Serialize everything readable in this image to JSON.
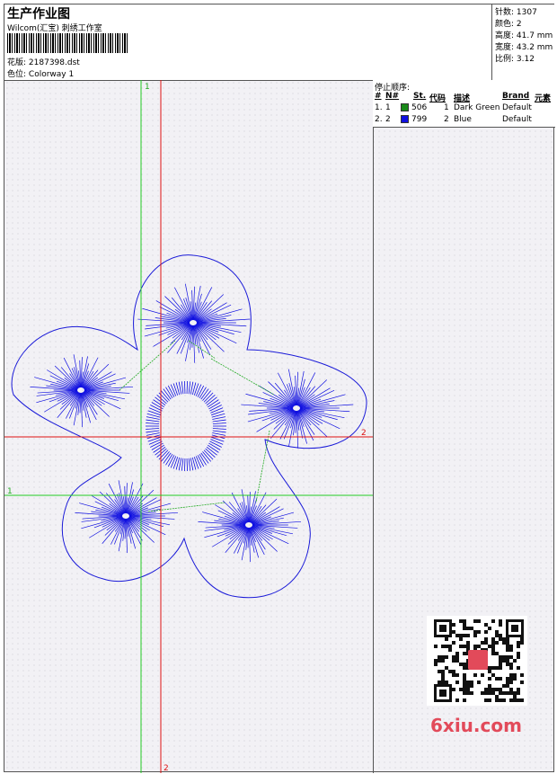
{
  "header": {
    "title": "生产作业图",
    "subtitle": "Wilcom(汇宝) 刺绣工作室",
    "file_label": "花版:",
    "file_name": "2187398.dst",
    "colorway_label": "色位:",
    "colorway": "Colorway 1"
  },
  "stats": {
    "stitches": "针数: 1307",
    "colors": "颜色: 2",
    "height": "高度: 41.7 mm",
    "width": "宽度: 43.2 mm",
    "scale": "比例: 3.12"
  },
  "stop_sequence": {
    "title": "停止顺序:",
    "headers": [
      "#",
      "N#",
      "St.",
      "代码",
      "描述",
      "Brand",
      "元素"
    ],
    "rows": [
      {
        "idx": "1.",
        "n": "1",
        "color": "#1a8a1a",
        "st": "506",
        "code": "1",
        "desc": "Dark Green",
        "brand": "Default"
      },
      {
        "idx": "2.",
        "n": "2",
        "color": "#1010e0",
        "st": "799",
        "code": "2",
        "desc": "Blue",
        "brand": "Default"
      }
    ]
  },
  "guides": {
    "green_v": "1",
    "red_v": "2",
    "green_h": "1",
    "red_h": "2"
  },
  "watermark": {
    "logo": "6xiu.com"
  }
}
